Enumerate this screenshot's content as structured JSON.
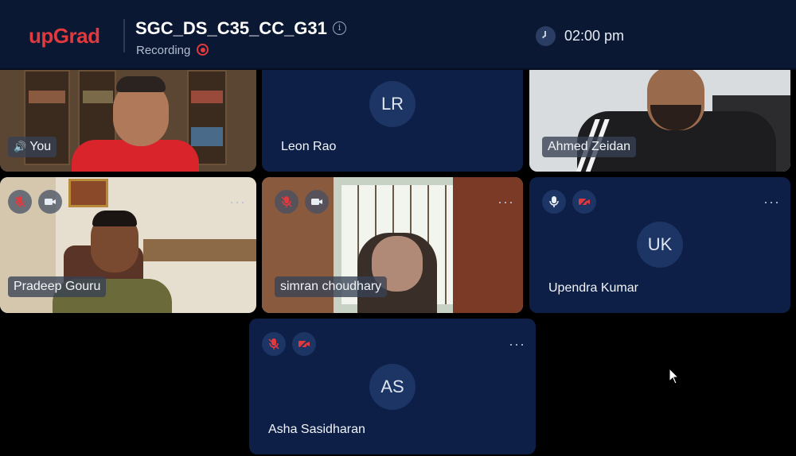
{
  "header": {
    "logo": "upGrad",
    "meeting_title": "SGC_DS_C35_CC_G31",
    "recording_label": "Recording",
    "time": "02:00 pm",
    "colors": {
      "background": "#0a1833",
      "brand": "#e0393e",
      "tile": "#0d1f47"
    }
  },
  "participants": [
    {
      "name": "You",
      "initials": "",
      "video": true
    },
    {
      "name": "Leon Rao",
      "initials": "LR",
      "video": false
    },
    {
      "name": "Ahmed Zeidan",
      "initials": "",
      "video": true
    },
    {
      "name": "Pradeep Gouru",
      "initials": "",
      "video": true,
      "mic": "muted",
      "camera": "on"
    },
    {
      "name": "simran choudhary",
      "initials": "",
      "video": true,
      "mic": "muted",
      "camera": "on"
    },
    {
      "name": "Upendra Kumar",
      "initials": "UK",
      "video": false,
      "mic": "on",
      "camera": "off"
    },
    {
      "name": "Asha Sasidharan",
      "initials": "AS",
      "video": false,
      "mic": "muted",
      "camera": "off"
    }
  ],
  "more_menu": "···"
}
